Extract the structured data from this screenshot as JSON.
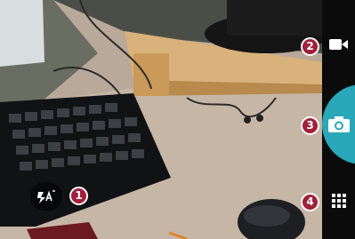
{
  "controls": {
    "flash": {
      "icon": "flash-auto-icon"
    },
    "video": {
      "icon": "video-camera-icon"
    },
    "shutter": {
      "icon": "camera-icon"
    },
    "menu": {
      "icon": "grid-menu-icon"
    }
  },
  "callouts": {
    "flash": "1",
    "video": "2",
    "shutter": "3",
    "menu": "4"
  },
  "colors": {
    "shutter_accent": "#2aa7b8",
    "callout_fill": "#a0203a",
    "sidebar_bg": "#0b0b0b"
  }
}
